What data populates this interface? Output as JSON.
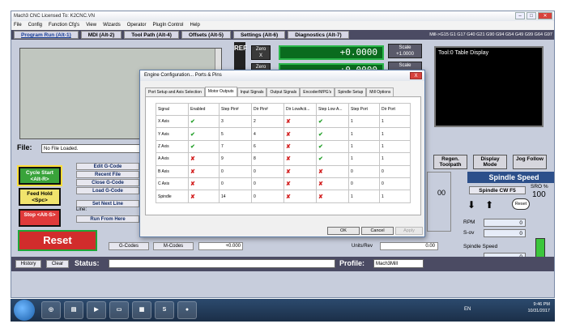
{
  "window": {
    "title": "Mach3 CNC  Licensed To: K2CNC.VN",
    "menu": [
      "File",
      "Config",
      "Function Cfg's",
      "View",
      "Wizards",
      "Operator",
      "PlugIn Control",
      "Help"
    ]
  },
  "tabs": [
    "Program Run (Alt-1)",
    "MDI (Alt-2)",
    "Tool Path (Alt-4)",
    "Offsets (Alt-5)",
    "Settings (Alt-6)",
    "Diagnostics (Alt-7)"
  ],
  "gcode_status": "Mill->G15  G1 G17 G40 G21 G90 G94 G54 G49 G99 G64 G97",
  "ref_label": "REF",
  "zero": {
    "label": "Zero",
    "x": "X",
    "y": "Y"
  },
  "dro": {
    "x_value": "+0.0000",
    "y_value": "+0.0000"
  },
  "scale": {
    "label": "Scale",
    "value": "+1.0000"
  },
  "tool_display": {
    "text": "Tool:0   Table Display"
  },
  "file": {
    "label": "File:",
    "value": "No File Loaded."
  },
  "buttons": {
    "cycle_start": "Cycle Start <Alt-R>",
    "feed_hold": "Feed Hold <Spc>",
    "stop": "Stop <Alt-S>",
    "edit_gcode": "Edit G-Code",
    "recent_file": "Recent File",
    "close_gcode": "Close G-Code",
    "load_gcode": "Load G-Code",
    "set_next_line": "Set Next Line",
    "line_label": "Line:",
    "run_from_here": "Run From Here",
    "reset": "Reset",
    "gcodes": "G-Codes",
    "mcodes": "M-Codes",
    "small_dro": "+0.000"
  },
  "units_rev": {
    "label": "Units/Rev",
    "value": "0.00"
  },
  "right_buttons": {
    "regen": "Regen. Toolpath",
    "display_mode": "Display Mode",
    "jog_follow": "Jog Follow"
  },
  "spindle": {
    "title": "Spindle Speed",
    "cw_button": "Spindle CW F5",
    "sro_label": "SRO %",
    "sro_value": "100",
    "reset": "Reset",
    "rpm_label": "RPM",
    "rpm_value": "0",
    "sov_label": "S-ov",
    "sov_value": "0",
    "speed_label": "Spindle Speed",
    "speed_value": "0",
    "partial_value": "00"
  },
  "status": {
    "history": "History",
    "clear": "Clear",
    "status_label": "Status:",
    "status_value": "",
    "profile_label": "Profile:",
    "profile_value": "Mach3Mill"
  },
  "dialog": {
    "title": "Engine Configuration... Ports & Pins",
    "close": "X",
    "tabs": [
      "Port Setup and Axis Selection",
      "Motor Outputs",
      "Input Signals",
      "Output Signals",
      "Encoder/MPG's",
      "Spindle Setup",
      "Mill Options"
    ],
    "active_tab": 1,
    "columns": [
      "Signal",
      "Enabled",
      "Step Pin#",
      "Dir Pin#",
      "Dir LowActi...",
      "Step Low A...",
      "Step Port",
      "Dir Port"
    ],
    "rows": [
      {
        "signal": "X Axis",
        "enabled": true,
        "step_pin": "3",
        "dir_pin": "2",
        "dir_low": false,
        "step_low": true,
        "step_port": "1",
        "dir_port": "1"
      },
      {
        "signal": "Y Axis",
        "enabled": true,
        "step_pin": "5",
        "dir_pin": "4",
        "dir_low": false,
        "step_low": true,
        "step_port": "1",
        "dir_port": "1"
      },
      {
        "signal": "Z Axis",
        "enabled": true,
        "step_pin": "7",
        "dir_pin": "6",
        "dir_low": false,
        "step_low": true,
        "step_port": "1",
        "dir_port": "1"
      },
      {
        "signal": "A Axis",
        "enabled": false,
        "step_pin": "9",
        "dir_pin": "8",
        "dir_low": false,
        "step_low": true,
        "step_port": "1",
        "dir_port": "1"
      },
      {
        "signal": "B Axis",
        "enabled": false,
        "step_pin": "0",
        "dir_pin": "0",
        "dir_low": false,
        "step_low": false,
        "step_port": "0",
        "dir_port": "0"
      },
      {
        "signal": "C Axis",
        "enabled": false,
        "step_pin": "0",
        "dir_pin": "0",
        "dir_low": false,
        "step_low": false,
        "step_port": "0",
        "dir_port": "0"
      },
      {
        "signal": "Spindle",
        "enabled": false,
        "step_pin": "14",
        "dir_pin": "0",
        "dir_low": false,
        "step_low": false,
        "step_port": "1",
        "dir_port": "1"
      }
    ],
    "ok": "OK",
    "cancel": "Cancel",
    "apply": "Apply"
  },
  "taskbar": {
    "lang": "EN",
    "time": "9:46 PM",
    "date": "10/31/2017"
  },
  "colors": {
    "dro_green": "#0a6b1e",
    "reset_red": "#d12c2c",
    "tab_bar": "#4b4b63",
    "check_green": "#24a02a",
    "x_red": "#d32222"
  }
}
